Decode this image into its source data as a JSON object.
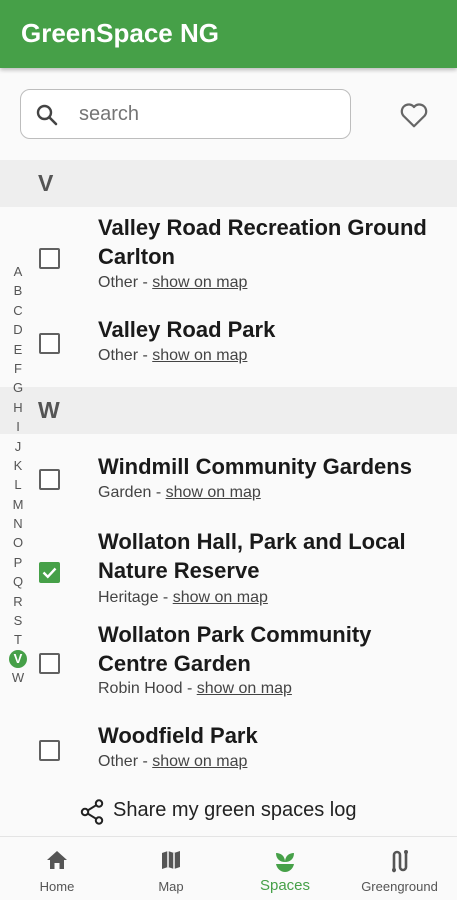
{
  "app": {
    "title": "GreenSpace NG",
    "accent_color": "#46a048"
  },
  "search": {
    "placeholder": "search",
    "value": "",
    "icon": "search-icon"
  },
  "favorites": {
    "icon": "heart-outline-icon"
  },
  "sections": [
    {
      "letter": "V",
      "items": [
        {
          "name": "Valley Road Recreation Ground Carlton",
          "category": "Other",
          "separator": " - ",
          "link": "show on map",
          "checked": false
        },
        {
          "name": "Valley Road Park",
          "category": "Other",
          "separator": " - ",
          "link": "show on map",
          "checked": false
        }
      ]
    },
    {
      "letter": "W",
      "items": [
        {
          "name": "Windmill Community Gardens",
          "category": "Garden",
          "separator": " - ",
          "link": "show on map",
          "checked": false
        },
        {
          "name": "Wollaton Hall, Park and Local Nature Reserve",
          "category": "Heritage",
          "separator": " - ",
          "link": "show on map",
          "checked": true
        },
        {
          "name": "Wollaton Park Community Centre Garden",
          "category": "Robin Hood",
          "separator": " - ",
          "link": "show on map",
          "checked": false
        },
        {
          "name": "Woodfield Park",
          "category": "Other",
          "separator": " - ",
          "link": "show on map",
          "checked": false
        }
      ]
    }
  ],
  "alphabet": [
    "A",
    "B",
    "C",
    "D",
    "E",
    "F",
    "G",
    "H",
    "I",
    "J",
    "K",
    "L",
    "M",
    "N",
    "O",
    "P",
    "Q",
    "R",
    "S",
    "T",
    "V",
    "W"
  ],
  "alphabet_active": "V",
  "share": {
    "label": "Share my green spaces log",
    "icon": "share-icon"
  },
  "bottom_nav": [
    {
      "label": "Home",
      "icon": "home-icon",
      "active": false
    },
    {
      "label": "Map",
      "icon": "map-icon",
      "active": false
    },
    {
      "label": "Spaces",
      "icon": "sprout-icon",
      "active": true
    },
    {
      "label": "Greenground",
      "icon": "route-icon",
      "active": false
    }
  ]
}
